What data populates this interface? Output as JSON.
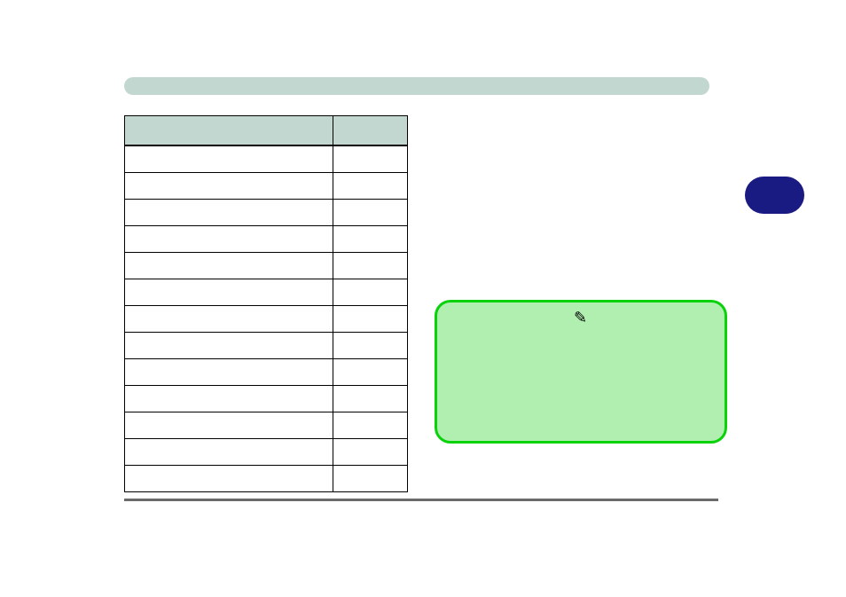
{
  "header": {
    "title": ""
  },
  "table": {
    "headers": [
      "",
      ""
    ],
    "rows": [
      [
        "",
        ""
      ],
      [
        "",
        ""
      ],
      [
        "",
        ""
      ],
      [
        "",
        ""
      ],
      [
        "",
        ""
      ],
      [
        "",
        ""
      ],
      [
        "",
        ""
      ],
      [
        "",
        ""
      ],
      [
        "",
        ""
      ],
      [
        "",
        ""
      ],
      [
        "",
        ""
      ],
      [
        "",
        ""
      ],
      [
        "",
        ""
      ]
    ]
  },
  "button": {
    "label": ""
  },
  "callout": {
    "text": "",
    "icon": "pencil-icon"
  },
  "colors": {
    "pale_green_fill": "#b1efb1",
    "green_border": "#0ad20a",
    "header_teal": "#c3d7d1",
    "navy_pill": "#191a82",
    "rule_gray": "#6b6b6b"
  }
}
